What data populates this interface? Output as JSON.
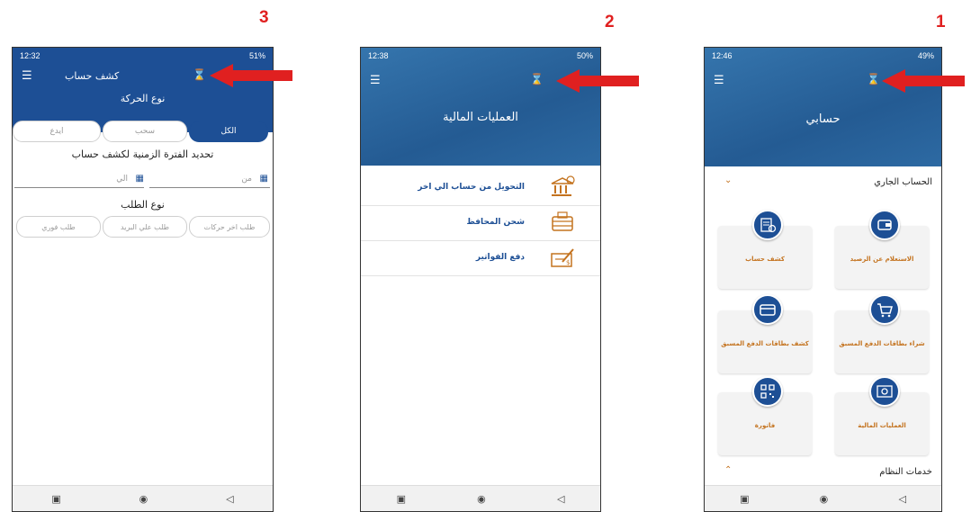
{
  "step_numbers": [
    "3",
    "2",
    "1"
  ],
  "phone3": {
    "status_time": "12:32",
    "status_right": "51%",
    "title": "كشف حساب",
    "movement_type_title": "نوع الحركة",
    "segments": [
      "الكل",
      "سحب",
      "ايدع"
    ],
    "period_title": "تحديد الفترة الزمنية لكشف حساب",
    "from_label": "من",
    "to_label": "الي",
    "request_type_title": "نوع الطلب",
    "request_options": [
      "طلب اخر حركات",
      "طلب علي البريد",
      "طلب فوري"
    ]
  },
  "phone2": {
    "status_time": "12:38",
    "status_right": "50%",
    "hero_title": "العمليات المالية",
    "items": [
      "التحويل من حساب الي اخر",
      "شحن المحافظ",
      "دفع الفواتير"
    ]
  },
  "phone1": {
    "status_time": "12:46",
    "status_right": "49%",
    "hero_title": "حسابي",
    "section_current": "الحساب الجاري",
    "tiles": [
      "الاستعلام عن الرصيد",
      "كشف حساب",
      "شراء بطاقات الدفع المسبق",
      "كشف بطاقات الدفع المسبق",
      "العمليات المالية",
      "فاتورة"
    ],
    "section_system": "خدمات النظام"
  },
  "icons": [
    "hamburger-icon",
    "hourglass-icon",
    "red-arrow-icon",
    "calendar-icon",
    "chevron-down-icon",
    "chevron-up-icon",
    "wallet-icon",
    "statement-icon",
    "cart-icon",
    "card-icon",
    "money-icon",
    "qr-icon",
    "bank-icon",
    "wallet-charge-icon",
    "bill-icon"
  ],
  "colors": {
    "primary": "#1d4f95",
    "accent": "#c4731f",
    "arrow": "#e02020"
  }
}
